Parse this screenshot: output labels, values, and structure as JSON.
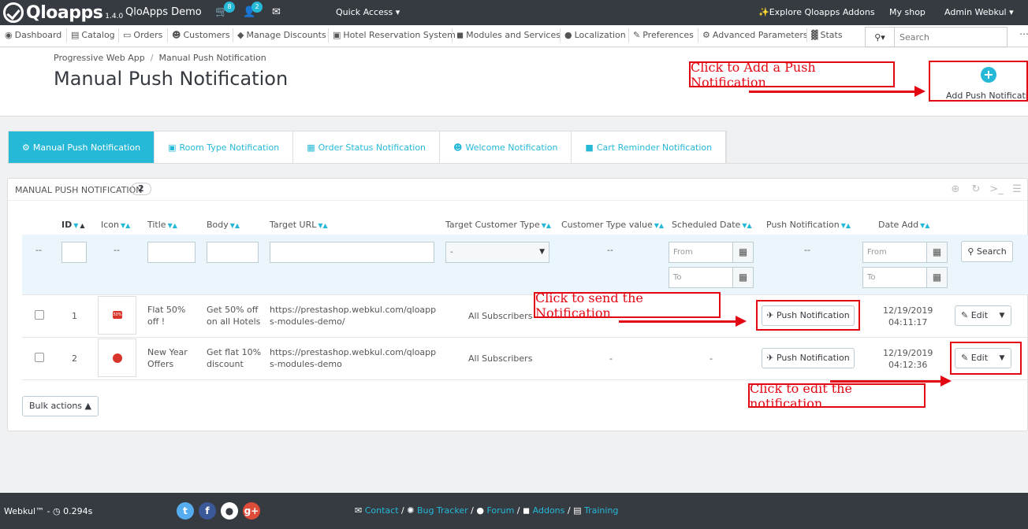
{
  "topbar": {
    "logo_text": "Qloapps",
    "version": "1.4.0",
    "shop_name": "QloApps Demo",
    "cart_badge": "8",
    "user_badge": "2",
    "quick_access": "Quick Access",
    "explore": "Explore Qloapps Addons",
    "my_shop": "My shop",
    "admin": "Admin Webkul"
  },
  "nav": {
    "items": [
      "Dashboard",
      "Catalog",
      "Orders",
      "Customers",
      "Manage Discounts",
      "Hotel Reservation System",
      "Modules and Services",
      "Localization",
      "Preferences",
      "Advanced Parameters",
      "Stats"
    ],
    "search_placeholder": "Search"
  },
  "header": {
    "breadcrumb": [
      "Progressive Web App",
      "Manual Push Notification"
    ],
    "title": "Manual Push Notification",
    "add_label": "Add Push Notification"
  },
  "annotations": {
    "add": "Click to Add a Push Notification",
    "send": "Click to send the Notification",
    "edit": "Click to edit the notification"
  },
  "tabs": [
    "Manual Push Notification",
    "Room Type Notification",
    "Order Status Notification",
    "Welcome Notification",
    "Cart Reminder Notification"
  ],
  "panel": {
    "title": "Manual Push Notification",
    "count": "2"
  },
  "table": {
    "columns": [
      "ID",
      "Icon",
      "Title",
      "Body",
      "Target URL",
      "Target Customer Type",
      "Customer Type value",
      "Scheduled Date",
      "Push Notification",
      "Date Add"
    ],
    "filter": {
      "dash": "--",
      "select_value": "-",
      "from": "From",
      "to": "To",
      "search": "Search"
    },
    "rows": [
      {
        "id": "1",
        "icon": "50%",
        "title": "Flat 50% off !",
        "body": "Get 50% off on all Hotels",
        "url": "https://prestashop.webkul.com/qloapps-modules-demo/",
        "customer_type": "All Subscribers",
        "type_value": "-",
        "scheduled": "-",
        "push": "Push Notification",
        "date": "12/19/2019",
        "time": "04:11:17",
        "edit": "Edit"
      },
      {
        "id": "2",
        "icon": "",
        "title": "New Year Offers",
        "body": "Get flat 10% discount",
        "url": "https://prestashop.webkul.com/qloapps-modules-demo",
        "customer_type": "All Subscribers",
        "type_value": "-",
        "scheduled": "-",
        "push": "Push Notification",
        "date": "12/19/2019",
        "time": "04:12:36",
        "edit": "Edit"
      }
    ],
    "bulk": "Bulk actions"
  },
  "footer": {
    "brand": "Webkul™ -",
    "time": "0.294s",
    "links": [
      "Contact",
      "Bug Tracker",
      "Forum",
      "Addons",
      "Training"
    ]
  },
  "colors": {
    "accent": "#25b9d7",
    "dark": "#363a41",
    "annotation": "#e30613"
  }
}
